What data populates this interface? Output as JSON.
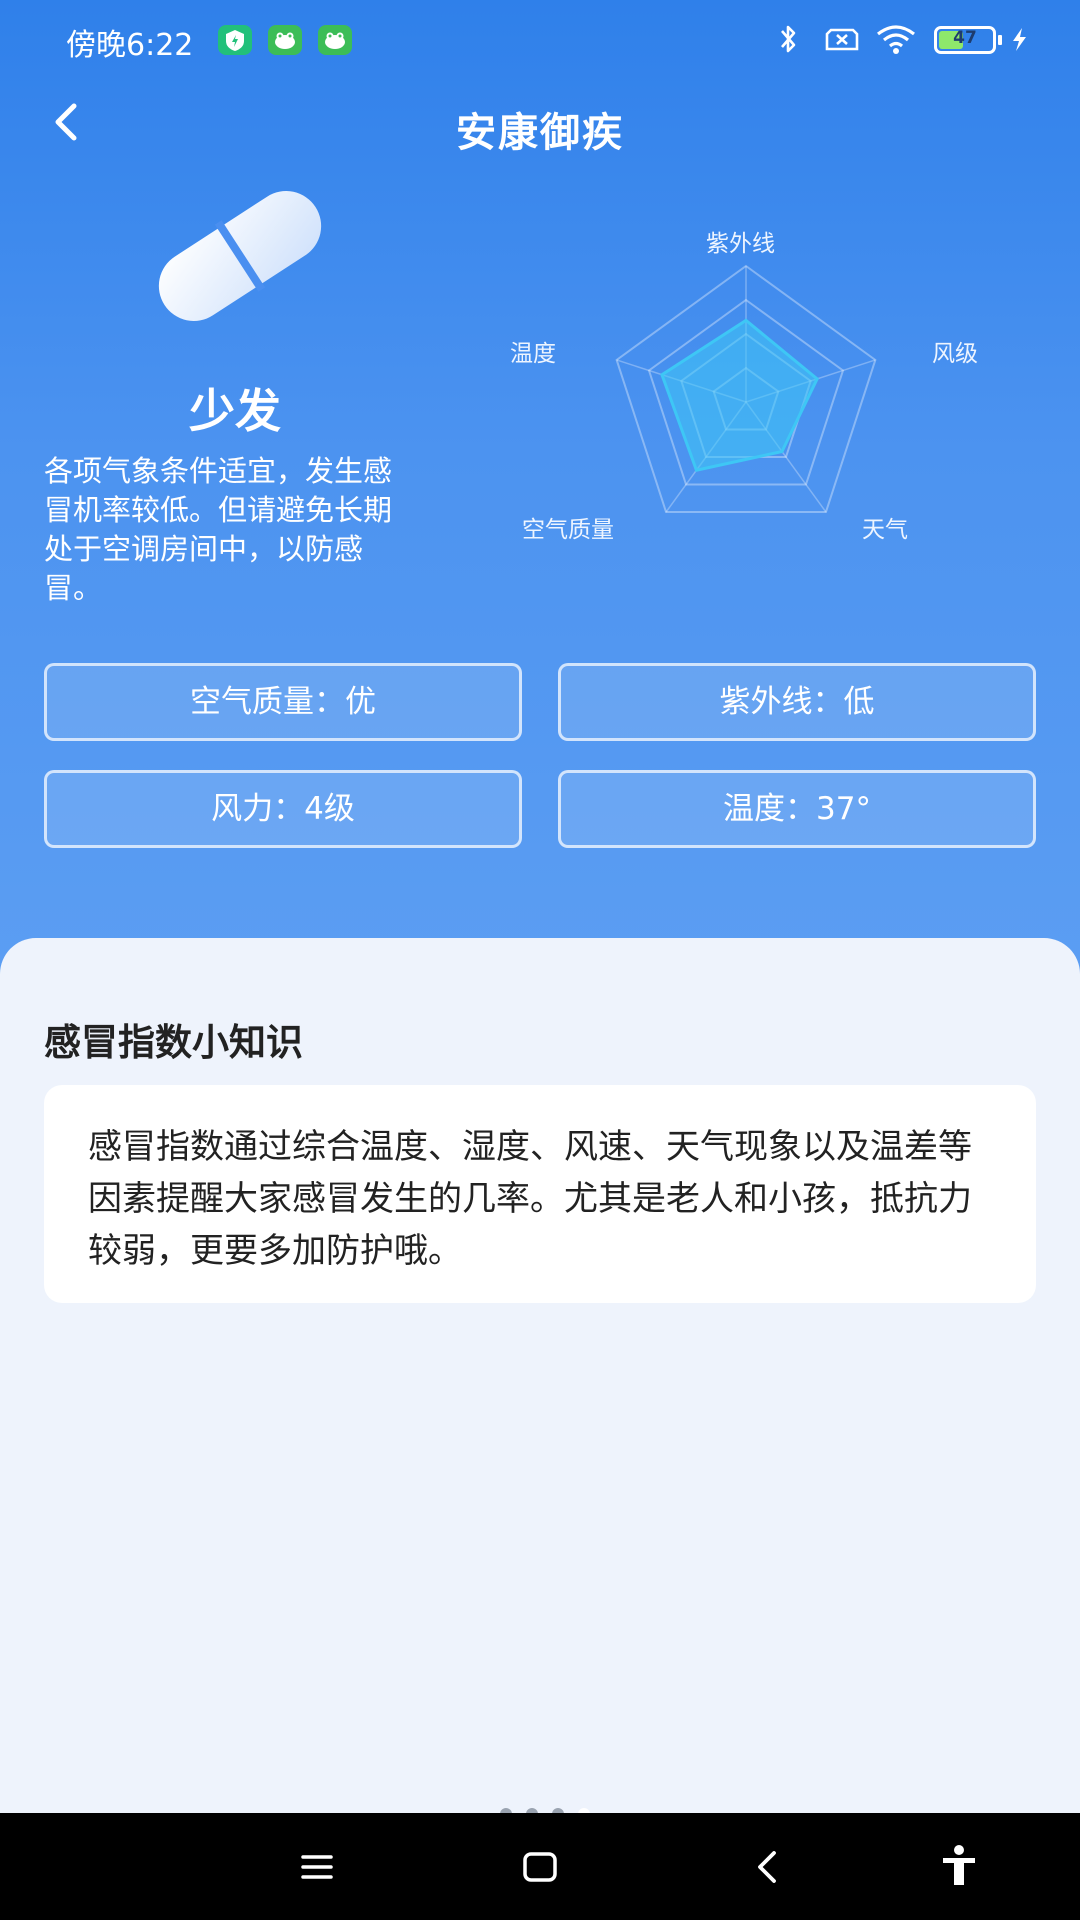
{
  "status_bar": {
    "time": "傍晚6:22",
    "battery": "47",
    "battery_level_percent": 47,
    "icons": [
      "shield-app-icon",
      "frog-app-icon",
      "frog-app-icon",
      "bluetooth-icon",
      "sim-off-icon",
      "wifi-icon",
      "battery-icon",
      "charging-icon"
    ]
  },
  "header": {
    "title": "安康御疾",
    "back_icon": "chevron-left-icon"
  },
  "summary": {
    "icon": "pill-icon",
    "level": "少发",
    "description": "各项气象条件适宜，发生感冒机率较低。但请避免长期处于空调房间中，以防感冒。"
  },
  "radar": {
    "labels": {
      "uv": "紫外线",
      "wind": "风级",
      "weather": "天气",
      "air": "空气质量",
      "temp": "温度"
    },
    "values": [
      0.6,
      0.55,
      0.45,
      0.62,
      0.65
    ]
  },
  "info": {
    "air_quality": "空气质量：优",
    "uv": "紫外线：低",
    "wind": "风力：4级",
    "temperature": "温度：37°"
  },
  "knowledge": {
    "title": "感冒指数小知识",
    "text": "感冒指数通过综合温度、湿度、风速、天气现象以及温差等因素提醒大家感冒发生的几率。尤其是老人和小孩，抵抗力较弱，更要多加防护哦。"
  },
  "nav_bar": {
    "icons": [
      "menu-icon",
      "home-icon",
      "back-icon",
      "accessibility-icon"
    ]
  },
  "colors": {
    "hero_top": "#2f80ea",
    "hero_bottom": "#5c9ef3",
    "radar_fill": "#3ec7f5",
    "sheet_bg": "#eef3fc"
  }
}
